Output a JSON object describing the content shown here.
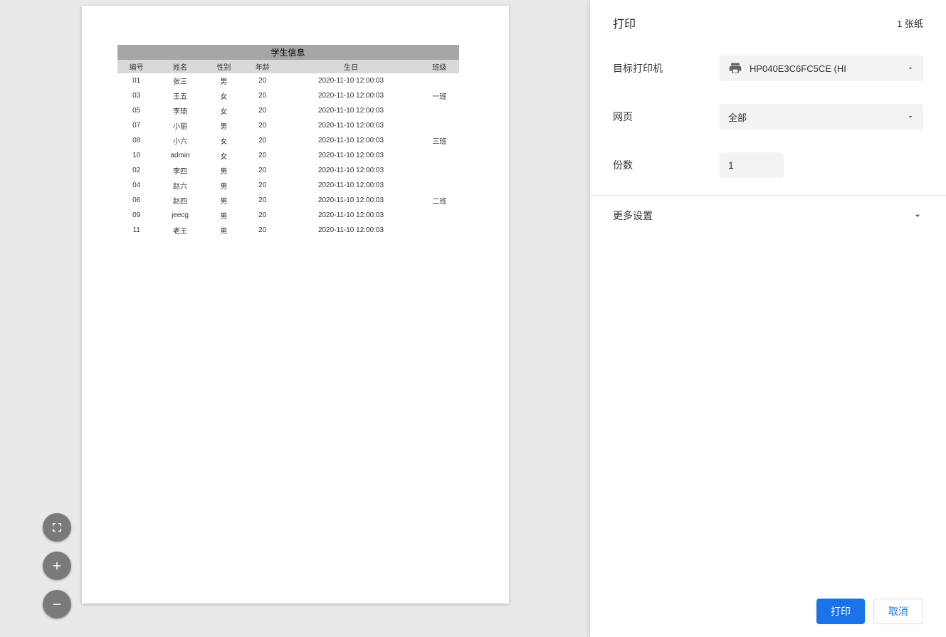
{
  "preview": {
    "table_title": "学生信息",
    "columns": [
      "编号",
      "姓名",
      "性别",
      "年龄",
      "生日",
      "班级"
    ],
    "rows": [
      {
        "id": "01",
        "name": "张三",
        "gender": "男",
        "age": "20",
        "birthday": "2020-11-10 12:00:03",
        "class": ""
      },
      {
        "id": "03",
        "name": "王五",
        "gender": "女",
        "age": "20",
        "birthday": "2020-11-10 12:00:03",
        "class": "一班"
      },
      {
        "id": "05",
        "name": "李琦",
        "gender": "女",
        "age": "20",
        "birthday": "2020-11-10 12:00:03",
        "class": ""
      },
      {
        "id": "07",
        "name": "小丽",
        "gender": "男",
        "age": "20",
        "birthday": "2020-11-10 12:00:03",
        "class": ""
      },
      {
        "id": "08",
        "name": "小六",
        "gender": "女",
        "age": "20",
        "birthday": "2020-11-10 12:00:03",
        "class": "三班"
      },
      {
        "id": "10",
        "name": "admin",
        "gender": "女",
        "age": "20",
        "birthday": "2020-11-10 12:00:03",
        "class": ""
      },
      {
        "id": "02",
        "name": "李四",
        "gender": "男",
        "age": "20",
        "birthday": "2020-11-10 12:00:03",
        "class": ""
      },
      {
        "id": "04",
        "name": "赵六",
        "gender": "男",
        "age": "20",
        "birthday": "2020-11-10 12:00:03",
        "class": ""
      },
      {
        "id": "06",
        "name": "赵四",
        "gender": "男",
        "age": "20",
        "birthday": "2020-11-10 12:00:03",
        "class": "二班"
      },
      {
        "id": "09",
        "name": "jeecg",
        "gender": "男",
        "age": "20",
        "birthday": "2020-11-10 12:00:03",
        "class": ""
      },
      {
        "id": "11",
        "name": "老王",
        "gender": "男",
        "age": "20",
        "birthday": "2020-11-10 12:00:03",
        "class": ""
      }
    ]
  },
  "panel": {
    "title": "打印",
    "page_count": "1 张纸",
    "destination_label": "目标打印机",
    "destination_value": "HP040E3C6FC5CE (HI",
    "pages_label": "网页",
    "pages_value": "全部",
    "copies_label": "份数",
    "copies_value": "1",
    "more_settings_label": "更多设置",
    "print_button": "打印",
    "cancel_button": "取消"
  }
}
